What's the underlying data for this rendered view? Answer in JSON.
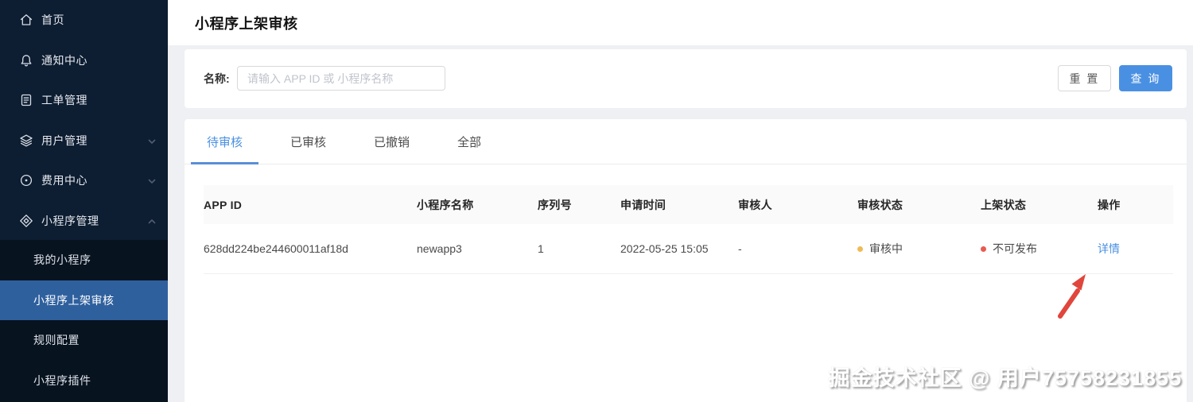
{
  "sidebar": {
    "items": [
      {
        "label": "首页",
        "icon": "home-icon"
      },
      {
        "label": "通知中心",
        "icon": "bell-icon"
      },
      {
        "label": "工单管理",
        "icon": "clipboard-icon"
      },
      {
        "label": "用户管理",
        "icon": "layers-icon",
        "chevron": "down"
      },
      {
        "label": "费用中心",
        "icon": "target-icon",
        "chevron": "down"
      },
      {
        "label": "小程序管理",
        "icon": "diamond-icon",
        "chevron": "up"
      }
    ],
    "submenu": [
      {
        "label": "我的小程序",
        "active": false
      },
      {
        "label": "小程序上架审核",
        "active": true
      },
      {
        "label": "规则配置",
        "active": false
      },
      {
        "label": "小程序插件",
        "active": false
      }
    ]
  },
  "header": {
    "title": "小程序上架审核"
  },
  "filter": {
    "name_label": "名称:",
    "input_value": "",
    "input_placeholder": "请输入 APP ID 或 小程序名称",
    "reset_label": "重 置",
    "query_label": "查 询"
  },
  "tabs": [
    {
      "label": "待审核",
      "active": true
    },
    {
      "label": "已审核",
      "active": false
    },
    {
      "label": "已撤销",
      "active": false
    },
    {
      "label": "全部",
      "active": false
    }
  ],
  "table": {
    "columns": [
      "APP ID",
      "小程序名称",
      "序列号",
      "申请时间",
      "审核人",
      "审核状态",
      "上架状态",
      "操作"
    ],
    "rows": [
      {
        "app_id": "628dd224be244600011af18d",
        "name": "newapp3",
        "serial": "1",
        "apply_time": "2022-05-25 15:05",
        "reviewer": "-",
        "review_status": "审核中",
        "publish_status": "不可发布",
        "action": "详情"
      }
    ]
  },
  "watermark": "掘金技术社区 @ 用户75758231855",
  "colors": {
    "sidebar_bg": "#0d1d32",
    "submenu_bg": "#081320",
    "selected_item_bg": "#2f609e",
    "accent_blue": "#4a90e2",
    "review_dot_yellow": "#eebb55",
    "publish_dot_red": "#ea5a50",
    "annotation_arrow_red": "#e0463b",
    "page_bg": "#eef0f3"
  }
}
